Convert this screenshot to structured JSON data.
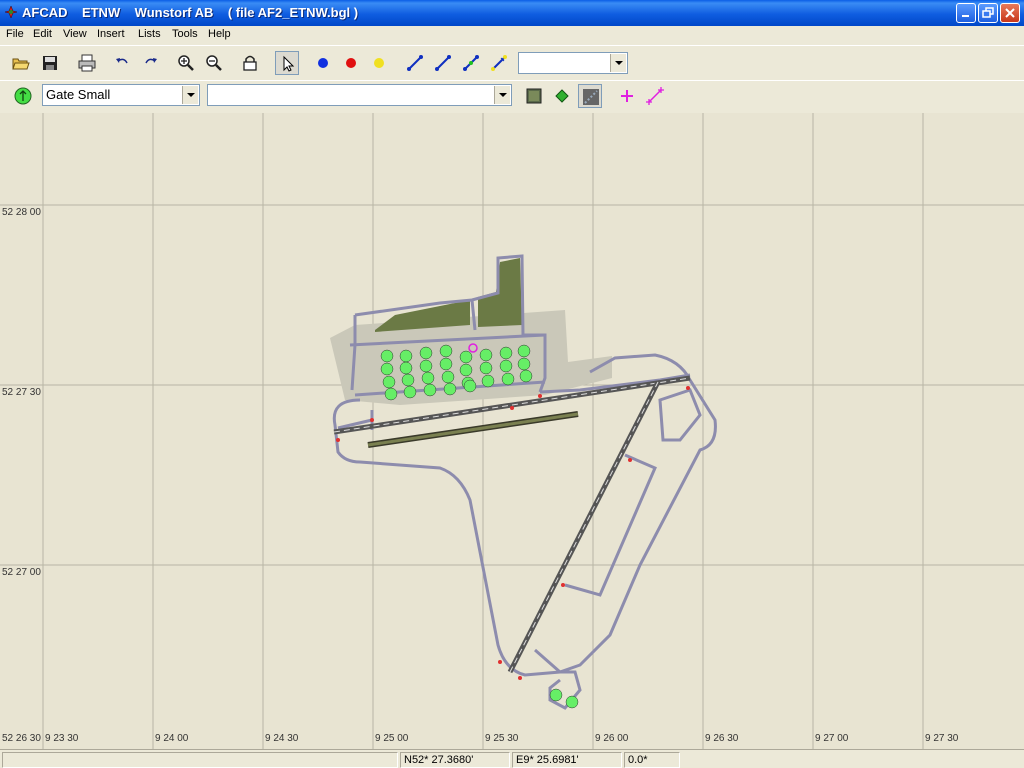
{
  "window": {
    "title": "AFCAD    ETNW    Wunstorf AB    ( file AF2_ETNW.bgl )"
  },
  "menu": [
    "File",
    "Edit",
    "View",
    "Insert",
    "Lists",
    "Tools",
    "Help"
  ],
  "toolbar1": {
    "buttons": [
      "open-icon",
      "save-icon",
      "print-icon",
      "undo-icon",
      "redo-icon",
      "zoom-in-icon",
      "zoom-out-icon",
      "lock-icon",
      "select-arrow-icon",
      "blue-node-icon",
      "red-node-icon",
      "yellow-node-icon",
      "taxi-path-icon",
      "runway-path-icon",
      "parking-path-icon",
      "connect-path-icon"
    ],
    "dropdown_value": ""
  },
  "toolbar2": {
    "parking_type": "Gate Small",
    "parking_name": ""
  },
  "map": {
    "lat_labels": [
      "52 28 00",
      "52 27 30",
      "52 27 00",
      "52 26 30"
    ],
    "lon_labels": [
      "9 23 30",
      "9 24 00",
      "9 24 30",
      "9 25 00",
      "9 25 30",
      "9 26 00",
      "9 26 30",
      "9 27 00",
      "9 27 30"
    ]
  },
  "status": {
    "left": "",
    "lat": "N52* 27.3680'",
    "lon": "E9* 25.6981'",
    "heading": "0.0*"
  },
  "colors": {
    "title_bar": "#0a5ee6",
    "map_background": "#e8e4d2",
    "taxiway": "#8a8aa8",
    "apron": "#c9c8b8",
    "grass": "#6b7a45",
    "parking_spot": "#66ee66",
    "runway": "#555555"
  }
}
